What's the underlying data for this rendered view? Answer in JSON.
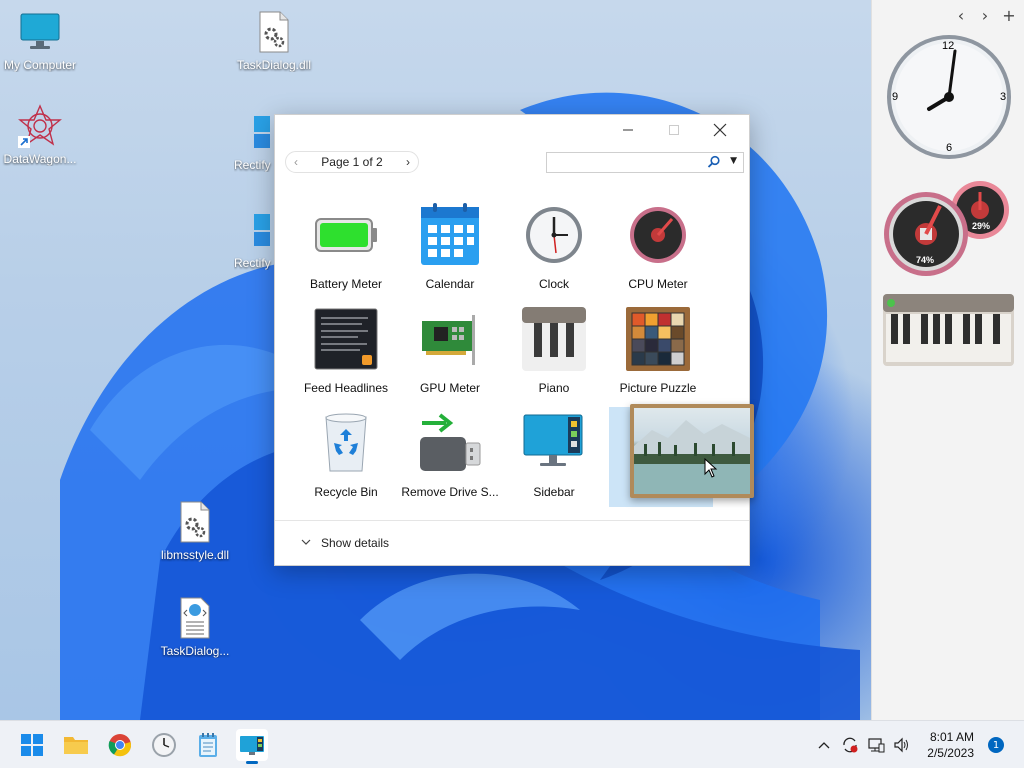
{
  "desktop": {
    "icons": [
      {
        "label": "My Computer",
        "icon": "monitor-icon"
      },
      {
        "label": "DataWagon...",
        "icon": "datawagon-icon"
      },
      {
        "label": "TaskDialog.dll",
        "icon": "dll-file-icon"
      },
      {
        "label": "Rectify",
        "icon": "rectify-icon"
      },
      {
        "label": "Rectify",
        "icon": "rectify-icon"
      },
      {
        "label": "libmsstyle.dll",
        "icon": "dll-file-icon"
      },
      {
        "label": "TaskDialog...",
        "icon": "web-file-icon"
      }
    ]
  },
  "sidebar": {
    "nav": {
      "prev": "‹",
      "next": "›",
      "add": "+"
    },
    "clock": {
      "n12": "12",
      "n3": "3",
      "n6": "6",
      "n9": "9"
    },
    "cpu_meter": {
      "cpu": "74%",
      "memory": "29%"
    }
  },
  "dialog": {
    "pager": {
      "label": "Page 1 of 2",
      "prev": "‹",
      "next": "›"
    },
    "search": {
      "placeholder": ""
    },
    "gadgets": [
      {
        "name": "Battery Meter",
        "icon": "battery-icon"
      },
      {
        "name": "Calendar",
        "icon": "calendar-icon"
      },
      {
        "name": "Clock",
        "icon": "clock-icon"
      },
      {
        "name": "CPU Meter",
        "icon": "cpu-meter-icon"
      },
      {
        "name": "Feed Headlines",
        "icon": "feed-icon"
      },
      {
        "name": "GPU Meter",
        "icon": "gpu-card-icon"
      },
      {
        "name": "Piano",
        "icon": "piano-icon"
      },
      {
        "name": "Picture Puzzle",
        "icon": "puzzle-icon"
      },
      {
        "name": "Recycle Bin",
        "icon": "recycle-bin-icon"
      },
      {
        "name": "Remove Drive S...",
        "icon": "usb-drive-icon"
      },
      {
        "name": "Sidebar",
        "icon": "sidebar-monitor-icon"
      },
      {
        "name": "",
        "icon": "slideshow-icon"
      }
    ],
    "footer": {
      "show_details": "Show details"
    }
  },
  "taskbar": {
    "apps": [
      "start-icon",
      "file-explorer-icon",
      "chrome-icon",
      "clock-app-icon",
      "notepad-icon",
      "gadgets-icon"
    ],
    "time": "8:01 AM",
    "date": "2/5/2023",
    "notifications": "1"
  },
  "colors": {
    "accent": "#0067c0",
    "selection": "#cce4f7",
    "sidebar_bg": "#f3f3f3"
  }
}
